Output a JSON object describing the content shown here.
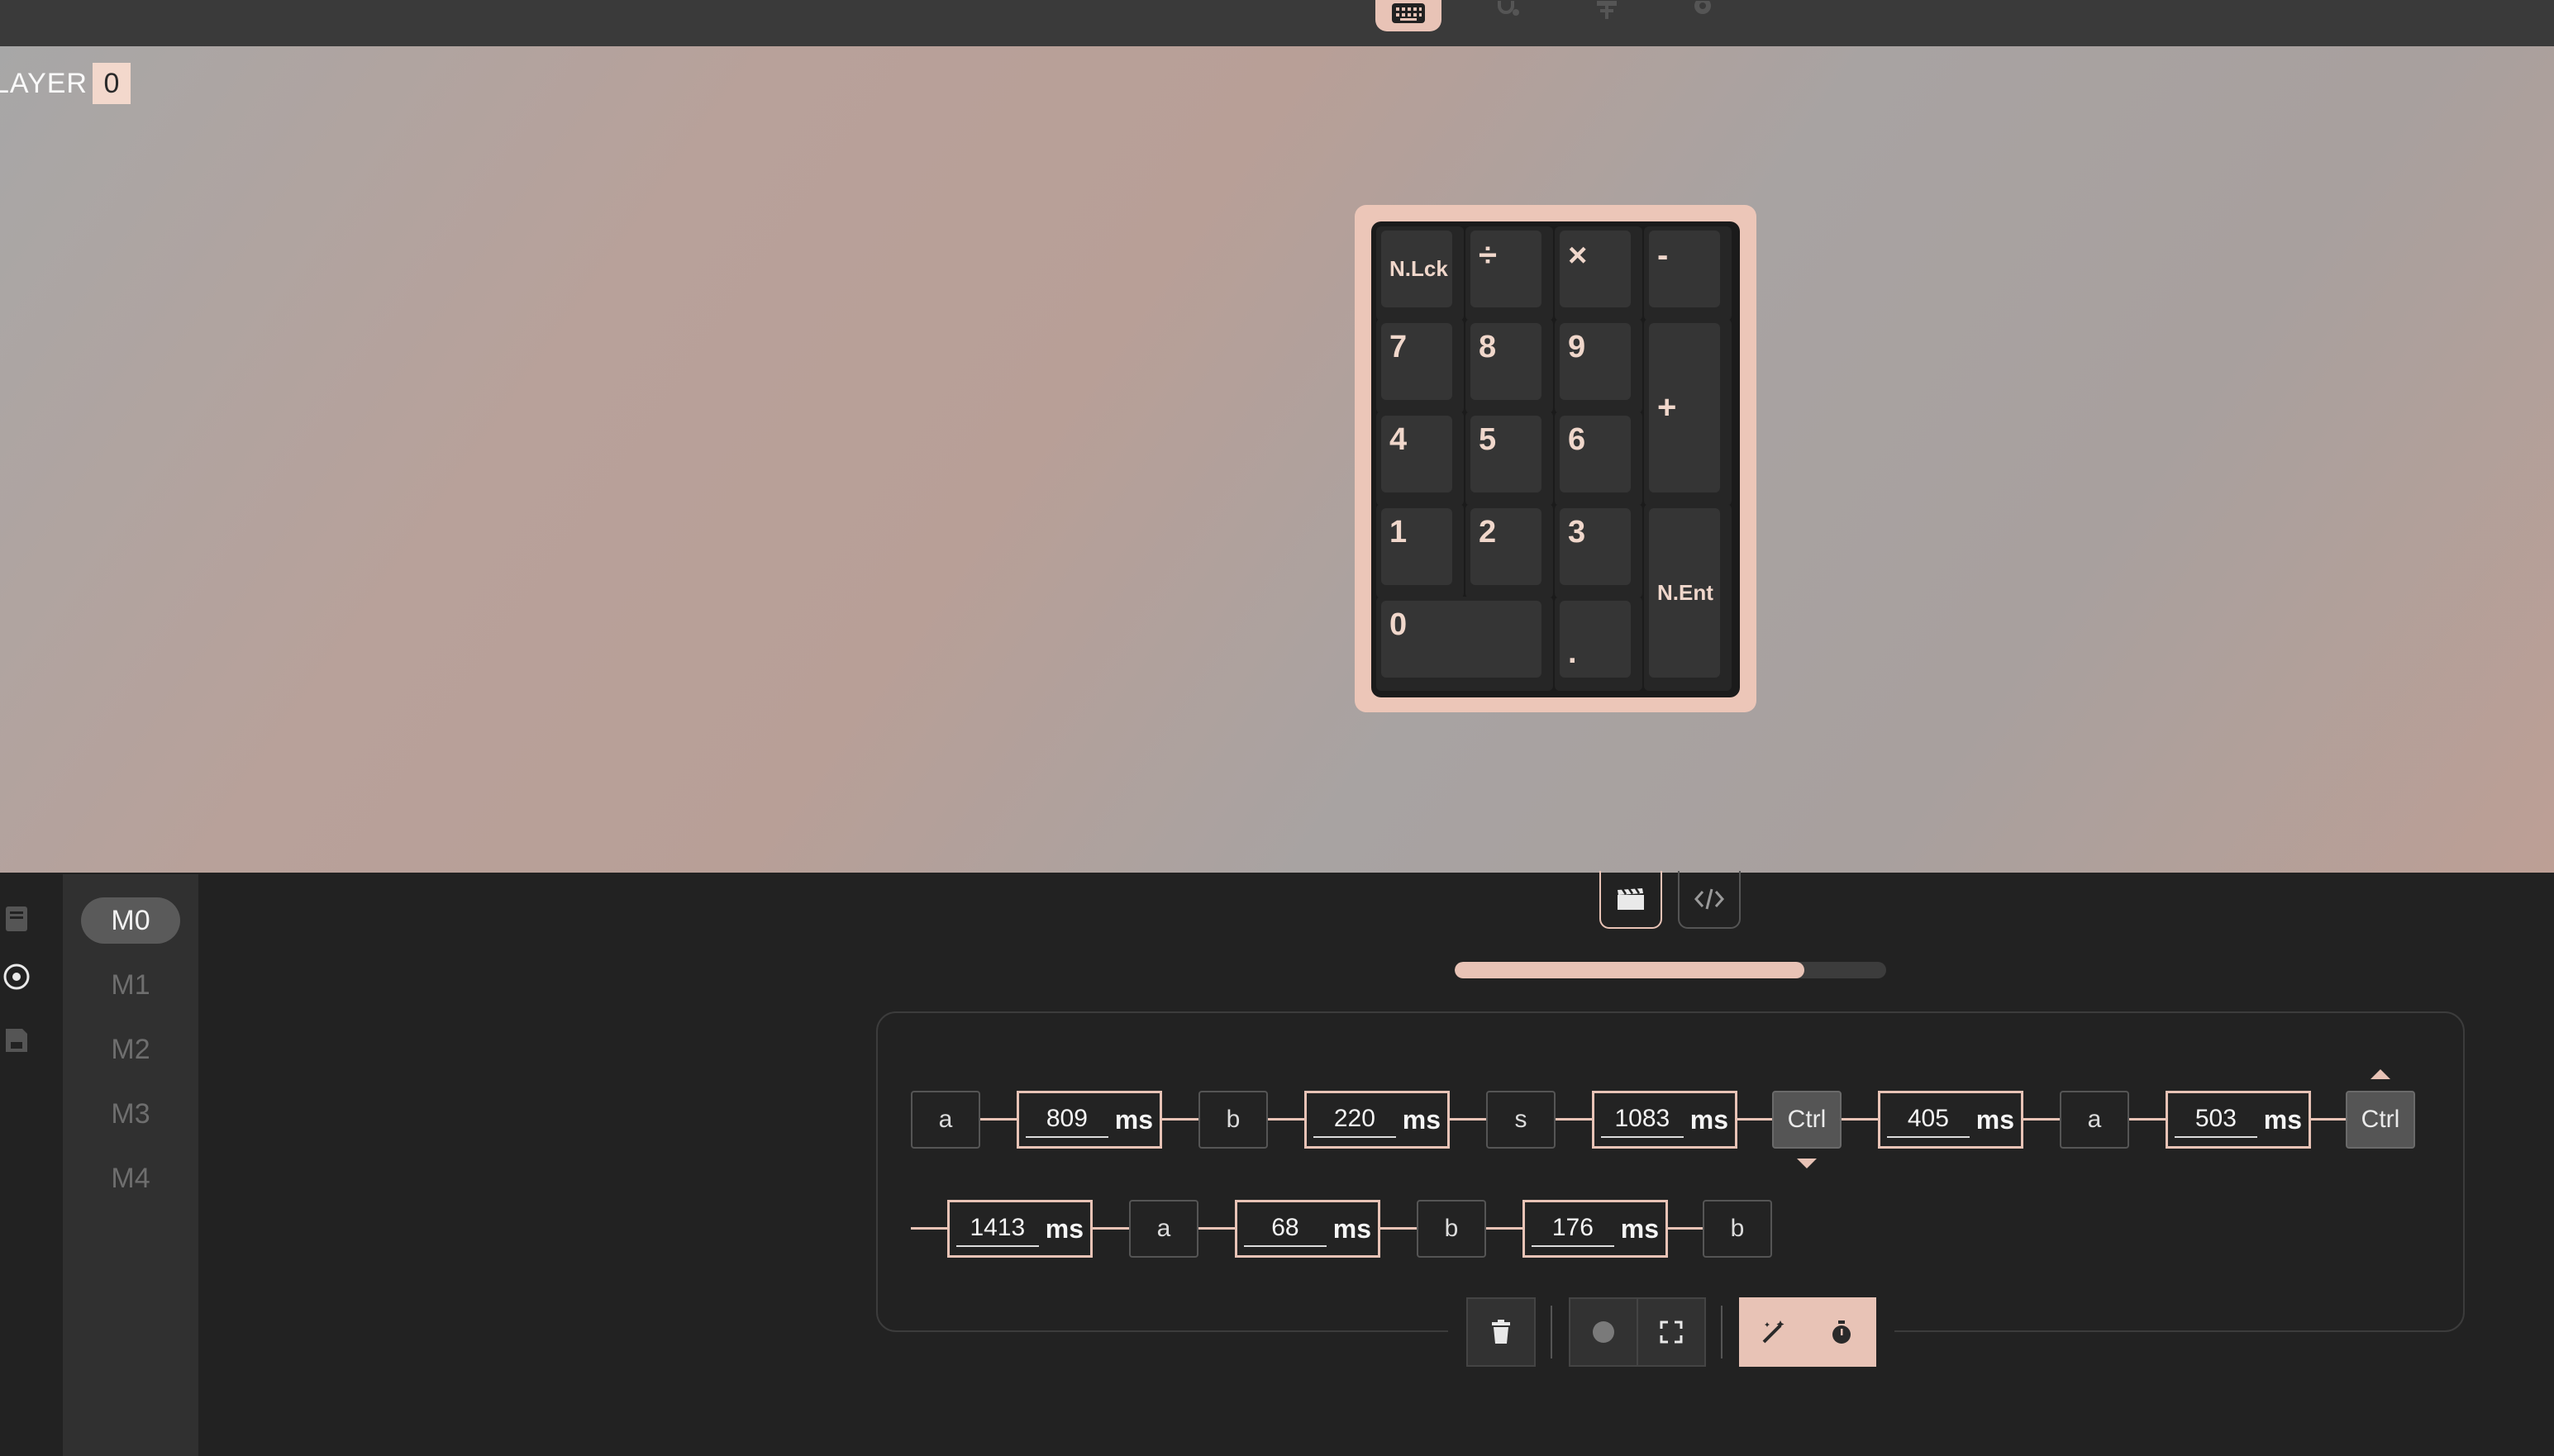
{
  "colors": {
    "accent": "#e8c3b6",
    "background": "#222222",
    "topbar": "#3a3a3a"
  },
  "topbar": {
    "icons": [
      {
        "name": "keyboard-icon",
        "active": true
      },
      {
        "name": "stethoscope-icon",
        "active": false
      },
      {
        "name": "sliders-icon",
        "active": false
      },
      {
        "name": "gear-icon",
        "active": false
      }
    ]
  },
  "layer": {
    "label": "LAYER",
    "value": "0"
  },
  "keypad": {
    "keys": [
      {
        "id": "num-lock",
        "label": "N.Lck"
      },
      {
        "id": "divide",
        "label": "÷"
      },
      {
        "id": "multiply",
        "label": "×"
      },
      {
        "id": "minus",
        "label": "-"
      },
      {
        "id": "7",
        "label": "7"
      },
      {
        "id": "8",
        "label": "8"
      },
      {
        "id": "9",
        "label": "9"
      },
      {
        "id": "plus",
        "label": "+"
      },
      {
        "id": "4",
        "label": "4"
      },
      {
        "id": "5",
        "label": "5"
      },
      {
        "id": "6",
        "label": "6"
      },
      {
        "id": "1",
        "label": "1"
      },
      {
        "id": "2",
        "label": "2"
      },
      {
        "id": "3",
        "label": "3"
      },
      {
        "id": "num-enter",
        "label": "N.Ent"
      },
      {
        "id": "0",
        "label": "0"
      },
      {
        "id": "dot",
        "label": "."
      }
    ]
  },
  "side_icons": [
    "book-icon",
    "target-icon",
    "save-icon"
  ],
  "macros": {
    "items": [
      "M0",
      "M1",
      "M2",
      "M3",
      "M4"
    ],
    "selected": "M0"
  },
  "modes": [
    {
      "name": "clapperboard-icon",
      "active": true
    },
    {
      "name": "code-icon",
      "active": false
    }
  ],
  "progress": {
    "value": 0.81
  },
  "sequence": {
    "unit": "ms",
    "row1": [
      {
        "type": "key",
        "label": "a"
      },
      {
        "type": "delay",
        "value": "809"
      },
      {
        "type": "key",
        "label": "b"
      },
      {
        "type": "delay",
        "value": "220"
      },
      {
        "type": "key",
        "label": "s"
      },
      {
        "type": "delay",
        "value": "1083"
      },
      {
        "type": "key",
        "label": "Ctrl",
        "mod": true,
        "dir": "down"
      },
      {
        "type": "delay",
        "value": "405"
      },
      {
        "type": "key",
        "label": "a"
      },
      {
        "type": "delay",
        "value": "503"
      },
      {
        "type": "key",
        "label": "Ctrl",
        "mod": true,
        "dir": "up"
      }
    ],
    "row2": [
      {
        "type": "delay",
        "value": "1413"
      },
      {
        "type": "key",
        "label": "a"
      },
      {
        "type": "delay",
        "value": "68"
      },
      {
        "type": "key",
        "label": "b"
      },
      {
        "type": "delay",
        "value": "176"
      },
      {
        "type": "key",
        "label": "b"
      }
    ]
  },
  "toolbar": {
    "buttons": [
      "trash-icon",
      "record-icon",
      "fullscreen-icon",
      "magic-wand-icon",
      "stopwatch-icon"
    ]
  }
}
